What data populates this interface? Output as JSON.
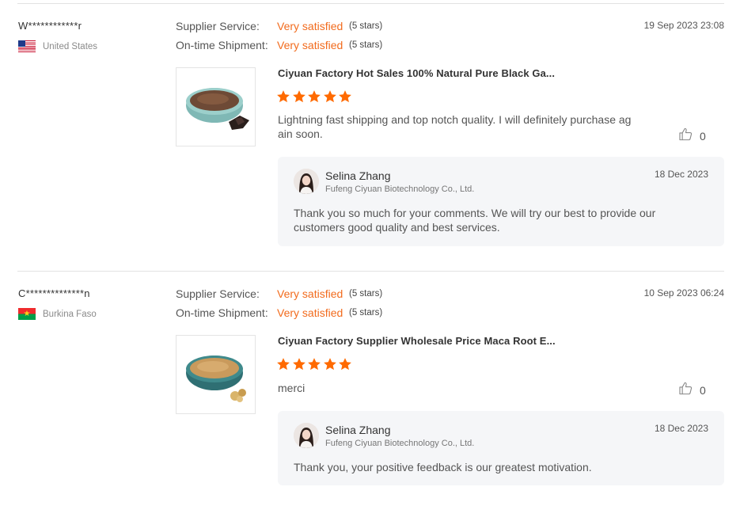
{
  "reviews": [
    {
      "buyer_name": "W************r",
      "country": "United States",
      "flag_icon": "us-flag-icon",
      "supplier_service_label": "Supplier Service:",
      "supplier_service_value": "Very satisfied",
      "supplier_service_stars": "(5 stars)",
      "shipment_label": "On-time Shipment:",
      "shipment_value": "Very satisfied",
      "shipment_stars": "(5 stars)",
      "date": "19 Sep 2023 23:08",
      "product_title": "Ciyuan Factory Hot Sales 100% Natural Pure Black Ga...",
      "rating": 5,
      "text": "Lightning fast shipping and top notch quality.  I will definitely purchase again soon.",
      "likes": "0",
      "reply": {
        "name": "Selina Zhang",
        "company": "Fufeng Ciyuan Biotechnology Co., Ltd.",
        "date": "18 Dec 2023",
        "text": "Thank you so much for your comments. We will try our best to provide our customers good quality and best services."
      }
    },
    {
      "buyer_name": "C**************n",
      "country": "Burkina Faso",
      "flag_icon": "burkina-faso-flag-icon",
      "supplier_service_label": "Supplier Service:",
      "supplier_service_value": "Very satisfied",
      "supplier_service_stars": "(5 stars)",
      "shipment_label": "On-time Shipment:",
      "shipment_value": "Very satisfied",
      "shipment_stars": "(5 stars)",
      "date": "10 Sep 2023 06:24",
      "product_title": "Ciyuan Factory Supplier Wholesale Price Maca Root E...",
      "rating": 5,
      "text": "merci",
      "likes": "0",
      "reply": {
        "name": "Selina Zhang",
        "company": "Fufeng Ciyuan Biotechnology Co., Ltd.",
        "date": "18 Dec 2023",
        "text": "Thank you, your positive feedback is our greatest motivation."
      }
    }
  ],
  "colors": {
    "accent": "#f26b1d",
    "star": "#ff6a00",
    "reply_bg": "#f5f6f8"
  }
}
